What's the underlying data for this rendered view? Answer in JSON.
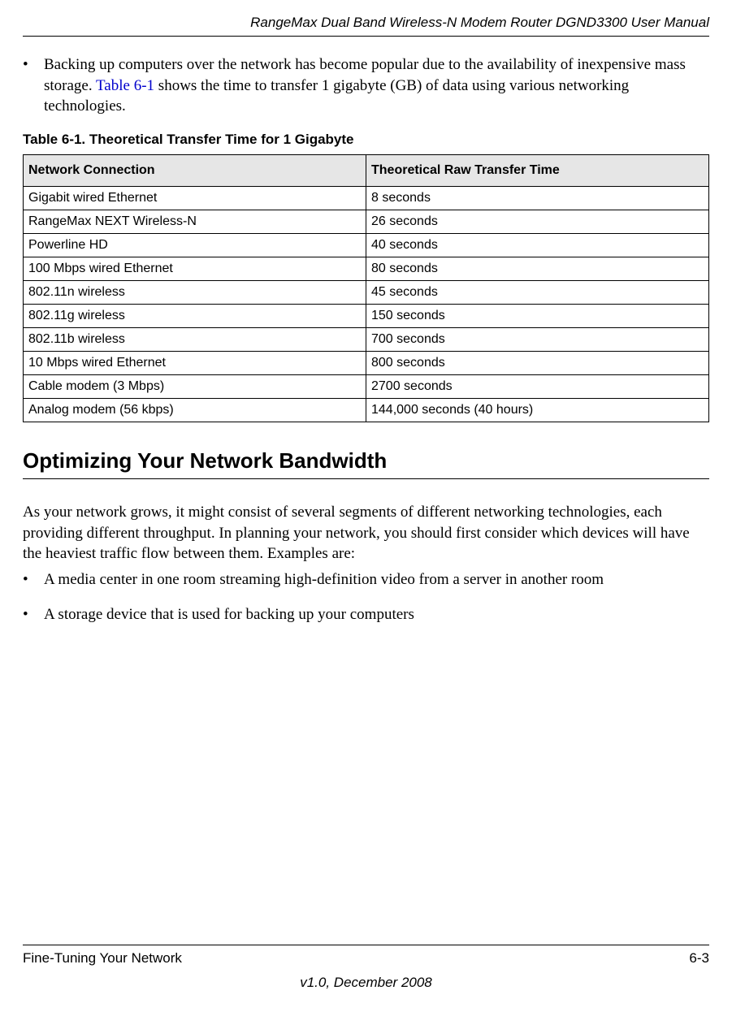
{
  "header": {
    "title": "RangeMax Dual Band Wireless-N Modem Router DGND3300 User Manual"
  },
  "intro": {
    "bullet_pre": "Backing up computers over the network has become popular due to the availability of inexpensive mass storage. ",
    "link_text": "Table 6-1",
    "bullet_post": " shows the time to transfer 1 gigabyte (GB) of data using various networking technologies."
  },
  "table": {
    "caption": "Table 6-1.   Theoretical Transfer Time for 1 Gigabyte",
    "col1": "Network Connection",
    "col2": "Theoretical Raw Transfer Time",
    "rows": [
      {
        "c1": "Gigabit wired Ethernet",
        "c2": "8 seconds"
      },
      {
        "c1": "RangeMax NEXT Wireless-N",
        "c2": "26 seconds"
      },
      {
        "c1": "Powerline HD",
        "c2": "40 seconds"
      },
      {
        "c1": "100 Mbps wired Ethernet",
        "c2": "80 seconds"
      },
      {
        "c1": "802.11n wireless",
        "c2": "45 seconds"
      },
      {
        "c1": "802.11g wireless",
        "c2": "150 seconds"
      },
      {
        "c1": "802.11b wireless",
        "c2": "700 seconds"
      },
      {
        "c1": "10 Mbps wired Ethernet",
        "c2": "800 seconds"
      },
      {
        "c1": "Cable modem (3 Mbps)",
        "c2": "2700 seconds"
      },
      {
        "c1": "Analog modem (56 kbps)",
        "c2": "144,000 seconds (40 hours)"
      }
    ]
  },
  "section": {
    "heading": "Optimizing Your Network Bandwidth",
    "para": "As your network grows, it might consist of several segments of different networking technologies, each providing different throughput. In planning your network, you should first consider which devices will have the heaviest traffic flow between them. Examples are:",
    "bullets": [
      "A media center in one room streaming high-definition video from a server in another room",
      "A storage device that is used for backing up your computers"
    ]
  },
  "footer": {
    "left": "Fine-Tuning Your Network",
    "right": "6-3",
    "center": "v1.0, December 2008"
  }
}
